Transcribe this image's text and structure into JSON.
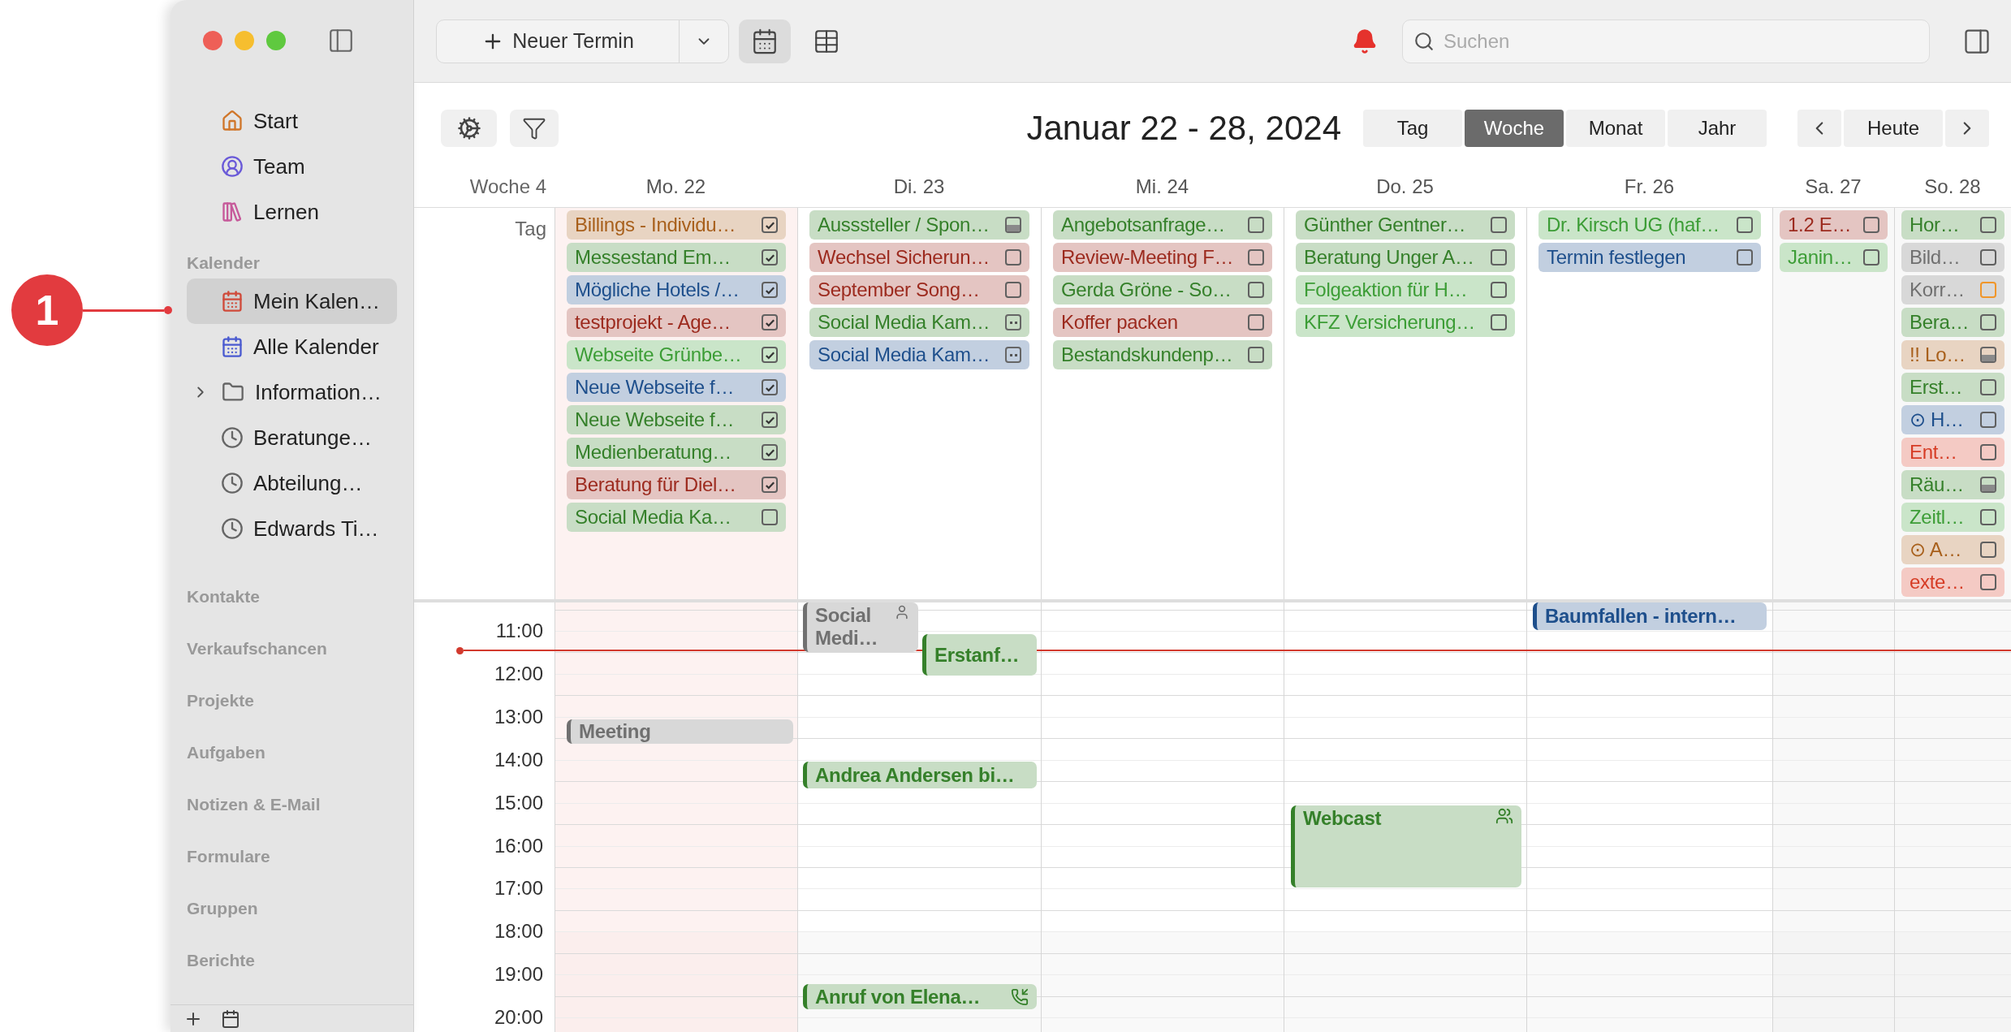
{
  "callout": {
    "label": "1"
  },
  "sidebar": {
    "nav": [
      {
        "label": "Start",
        "kind": "home"
      },
      {
        "label": "Team",
        "kind": "team"
      },
      {
        "label": "Lernen",
        "kind": "books"
      }
    ],
    "calendars_header": "Kalender",
    "calendars": [
      {
        "label": "Mein Kalen…",
        "kind": "calendar",
        "selected": true
      },
      {
        "label": "Alle Kalender",
        "kind": "calendar_all",
        "selected": false
      },
      {
        "label": "Information…",
        "kind": "folder",
        "selected": false,
        "expanded": false
      },
      {
        "label": "Beratunge…",
        "kind": "clock",
        "selected": false
      },
      {
        "label": "Abteilung…",
        "kind": "clock",
        "selected": false
      },
      {
        "label": "Edwards Ti…",
        "kind": "clock",
        "selected": false
      }
    ],
    "sections": [
      "Kontakte",
      "Verkaufschancen",
      "Projekte",
      "Aufgaben",
      "Notizen & E-Mail",
      "Formulare",
      "Gruppen",
      "Berichte"
    ]
  },
  "toolbar": {
    "new_button": "Neuer Termin",
    "views": [
      {
        "kind": "week",
        "selected": true
      },
      {
        "kind": "grid",
        "selected": false
      }
    ],
    "search": {
      "placeholder": "Suchen"
    }
  },
  "header": {
    "title": "Januar 22 - 28, 2024",
    "ranges": [
      {
        "label": "Tag",
        "selected": false
      },
      {
        "label": "Woche",
        "selected": true
      },
      {
        "label": "Monat",
        "selected": false
      },
      {
        "label": "Jahr",
        "selected": false
      }
    ],
    "today": "Heute"
  },
  "week_label": "Woche 4",
  "all_day_label": "Tag",
  "time_labels": [
    "11:00",
    "12:00",
    "13:00",
    "14:00",
    "15:00",
    "16:00",
    "17:00",
    "18:00",
    "19:00",
    "20:00"
  ],
  "days": [
    {
      "label": "Mo. 22",
      "selected": true,
      "all_day": [
        {
          "title": "Billings - Individu…",
          "color": "#a8601c",
          "kind": "task",
          "checked": true
        },
        {
          "title": "Messestand Em…",
          "color": "#35802a",
          "kind": "task",
          "checked": true
        },
        {
          "title": "Mögliche Hotels /…",
          "color": "#1e4f8c",
          "kind": "task",
          "checked": true
        },
        {
          "title": "testprojekt - Age…",
          "color": "#9c2a1e",
          "kind": "task",
          "checked": true
        },
        {
          "title": "Webseite Grünbe…",
          "color": "#3c9d36",
          "kind": "task",
          "checked": true
        },
        {
          "title": "Neue Webseite f…",
          "color": "#1e4f8c",
          "kind": "task",
          "checked": true
        },
        {
          "title": "Neue Webseite f…",
          "color": "#35802a",
          "kind": "task",
          "checked": true
        },
        {
          "title": "Medienberatung…",
          "color": "#35802a",
          "kind": "task",
          "checked": true
        },
        {
          "title": "Beratung für Diel…",
          "color": "#9c2a1e",
          "kind": "task",
          "checked": true
        },
        {
          "title": "Social Media Ka…",
          "color": "#35802a",
          "kind": "task",
          "checked": false
        }
      ],
      "events": [
        {
          "title": "Meeting",
          "color": "#707070",
          "kind": "plain"
        }
      ]
    },
    {
      "label": "Di. 23",
      "selected": false,
      "all_day": [
        {
          "title": "Ausssteller / Spon…",
          "color": "#35802a",
          "kind": "partial",
          "checked": false
        },
        {
          "title": "Wechsel Sicherun…",
          "color": "#9c2a1e",
          "kind": "task",
          "checked": false
        },
        {
          "title": "September Song…",
          "color": "#9c2a1e",
          "kind": "task",
          "checked": false
        },
        {
          "title": "Social Media Kam…",
          "color": "#35802a",
          "kind": "group",
          "checked": false
        },
        {
          "title": "Social Media Kam…",
          "color": "#1e4f8c",
          "kind": "group",
          "checked": false
        }
      ],
      "events": [
        {
          "title": "Social Medi…",
          "color": "#707070",
          "kind": "person"
        },
        {
          "title": "Erstanf…",
          "color": "#35802a",
          "kind": "plain"
        },
        {
          "title": "Andrea Andersen bi…",
          "color": "#35802a",
          "kind": "plain"
        },
        {
          "title": "Anruf von Elena…",
          "color": "#35802a",
          "kind": "call"
        }
      ]
    },
    {
      "label": "Mi. 24",
      "selected": false,
      "all_day": [
        {
          "title": "Angebotsanfrage…",
          "color": "#35802a",
          "kind": "task",
          "checked": false
        },
        {
          "title": "Review-Meeting F…",
          "color": "#9c2a1e",
          "kind": "task",
          "checked": false
        },
        {
          "title": "Gerda Gröne - So…",
          "color": "#35802a",
          "kind": "task",
          "checked": false
        },
        {
          "title": "Koffer packen",
          "color": "#9c2a1e",
          "kind": "task",
          "checked": false
        },
        {
          "title": "Bestandskundenp…",
          "color": "#35802a",
          "kind": "task",
          "checked": false
        }
      ]
    },
    {
      "label": "Do. 25",
      "selected": false,
      "all_day": [
        {
          "title": "Günther Gentner…",
          "color": "#35802a",
          "kind": "task",
          "checked": false
        },
        {
          "title": "Beratung Unger A…",
          "color": "#35802a",
          "kind": "task",
          "checked": false
        },
        {
          "title": "Folgeaktion für H…",
          "color": "#3c9d36",
          "kind": "task",
          "checked": false
        },
        {
          "title": "KFZ Versicherung…",
          "color": "#3c9d36",
          "kind": "task",
          "checked": false
        }
      ],
      "events": [
        {
          "title": "Webcast",
          "color": "#35802a",
          "kind": "group"
        }
      ]
    },
    {
      "label": "Fr. 26",
      "selected": false,
      "all_day": [
        {
          "title": "Dr. Kirsch UG (haf…",
          "color": "#3c9d36",
          "kind": "task",
          "checked": false
        },
        {
          "title": "Termin festlegen",
          "color": "#1e4f8c",
          "kind": "task",
          "checked": false
        }
      ],
      "events": [
        {
          "title": "Baumfallen - intern…",
          "color": "#1e4f8c",
          "kind": "plain"
        }
      ]
    },
    {
      "label": "Sa. 27",
      "selected": false,
      "all_day": [
        {
          "title": "1.2 E…",
          "color": "#9c2a1e",
          "kind": "task",
          "checked": false
        },
        {
          "title": "Janin…",
          "color": "#3c9d36",
          "kind": "task",
          "checked": false
        }
      ]
    },
    {
      "label": "So. 28",
      "selected": false,
      "all_day": [
        {
          "title": "Hor…",
          "color": "#35802a",
          "kind": "task",
          "checked": false
        },
        {
          "title": "Bild…",
          "color": "#707070",
          "kind": "task",
          "checked": false
        },
        {
          "title": "Korr…",
          "color": "#707070",
          "kind": "flagged",
          "checked": false
        },
        {
          "title": "Bera…",
          "color": "#35802a",
          "kind": "task",
          "checked": false
        },
        {
          "title": "!! Lo…",
          "color": "#a8601c",
          "kind": "partial",
          "checked": false
        },
        {
          "title": "Erst…",
          "color": "#35802a",
          "kind": "task",
          "checked": false
        },
        {
          "title": "⊙ H…",
          "color": "#1e4f8c",
          "kind": "task",
          "checked": false
        },
        {
          "title": "Ent…",
          "color": "#d63c25",
          "kind": "task",
          "checked": false
        },
        {
          "title": "Räu…",
          "color": "#35802a",
          "kind": "partial",
          "checked": false
        },
        {
          "title": "Zeitl…",
          "color": "#3c9d36",
          "kind": "task",
          "checked": false
        },
        {
          "title": "⊙ A…",
          "color": "#a8601c",
          "kind": "task",
          "checked": false
        },
        {
          "title": "exte…",
          "color": "#d63c25",
          "kind": "task",
          "checked": false
        }
      ]
    }
  ]
}
